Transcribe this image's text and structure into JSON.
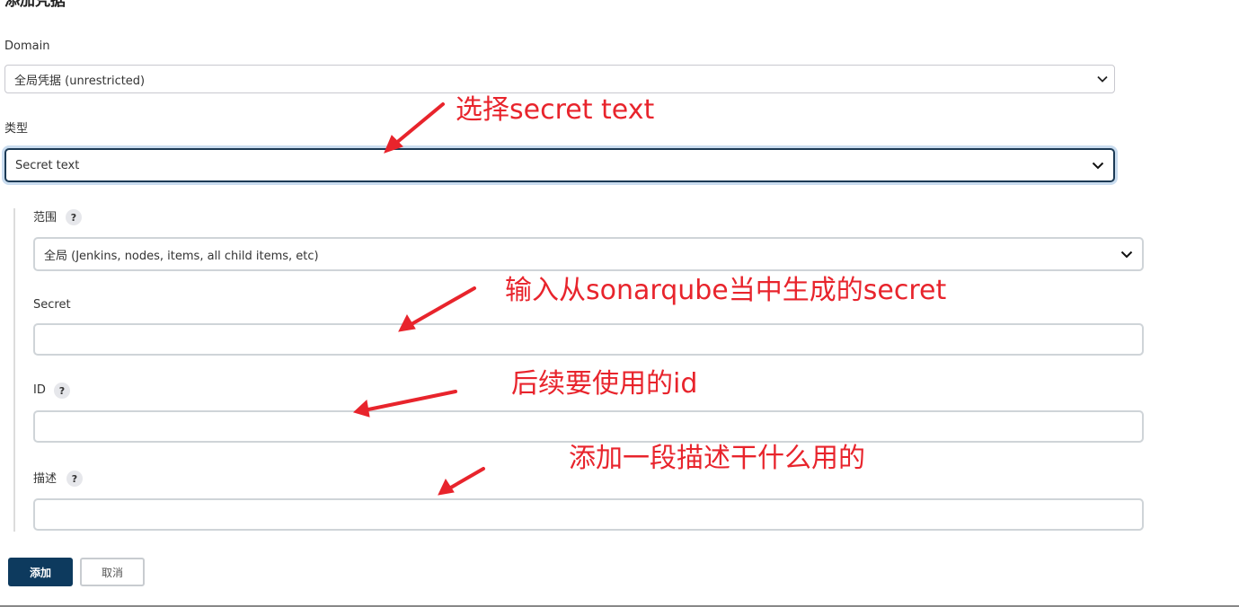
{
  "page": {
    "title": "添加凭据"
  },
  "domain": {
    "label": "Domain",
    "selected": "全局凭据 (unrestricted)"
  },
  "type": {
    "label": "类型",
    "selected": "Secret text"
  },
  "scope": {
    "label": "范围",
    "help": "?",
    "selected": "全局 (Jenkins, nodes, items, all child items, etc)"
  },
  "secret": {
    "label": "Secret",
    "value": ""
  },
  "id": {
    "label": "ID",
    "help": "?",
    "value": ""
  },
  "description": {
    "label": "描述",
    "help": "?",
    "value": ""
  },
  "buttons": {
    "add": "添加",
    "cancel": "取消"
  },
  "annotations": {
    "type_note": "选择secret text",
    "secret_note": "输入从sonarqube当中生成的secret",
    "id_note": "后续要使用的id",
    "desc_note": "添加一段描述干什么用的"
  },
  "colors": {
    "annotation": "#e8242c",
    "primary_button": "#0d3a5e",
    "focus_border": "#1c3a55"
  },
  "icons": [
    "chevron-down-icon",
    "help-icon",
    "red-arrow"
  ]
}
